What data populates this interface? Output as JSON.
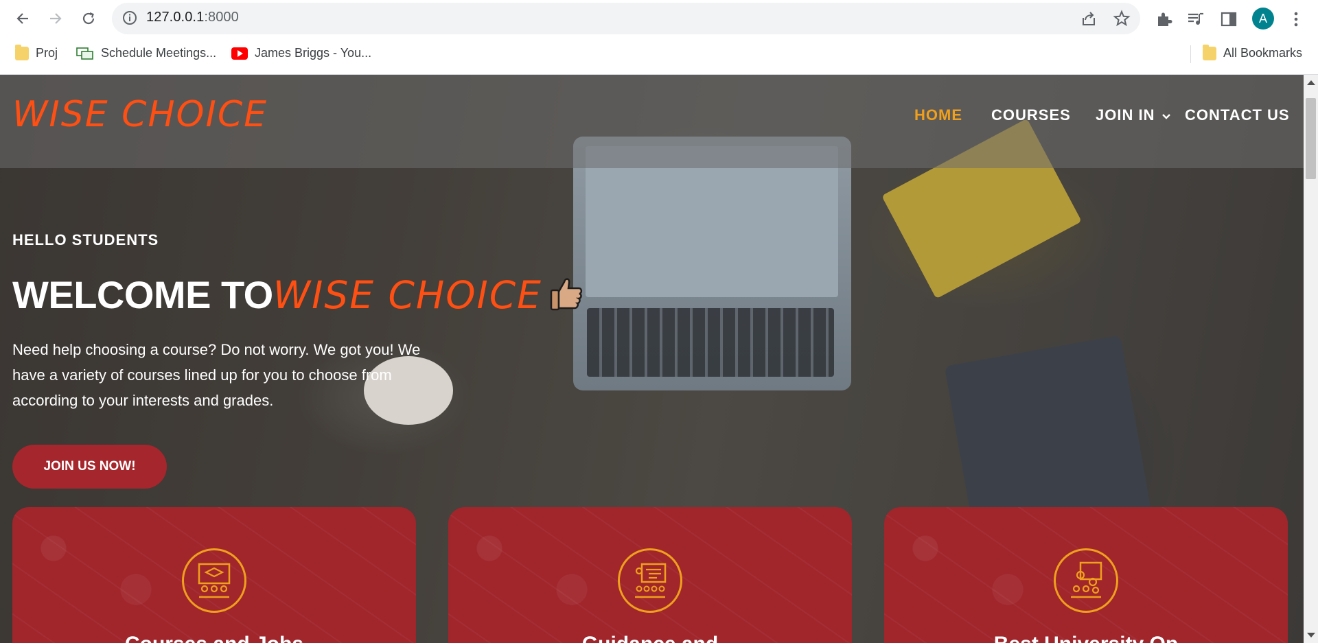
{
  "browser": {
    "url_host": "127.0.0.1",
    "url_port": ":8000",
    "avatar_letter": "A",
    "bookmarks": [
      {
        "label": "Proj",
        "icon": "folder-icon"
      },
      {
        "label": "Schedule Meetings...",
        "icon": "meetings-icon"
      },
      {
        "label": "James Briggs - You...",
        "icon": "youtube-icon"
      }
    ],
    "all_bookmarks_label": "All Bookmarks"
  },
  "site": {
    "logo": "WISE CHOICE",
    "nav": [
      "HOME",
      "COURSES",
      "JOIN IN",
      "CONTACT US"
    ],
    "active_nav": "HOME",
    "hero": {
      "subtitle": "HELLO STUDENTS",
      "title_prefix": "WELCOME TO",
      "title_brand": "WISE CHOICE",
      "description": "Need help choosing a course? Do not worry. We got you! We have a variety of courses lined up for you to choose from according to your interests and grades.",
      "cta": "JOIN US NOW!"
    },
    "cards": [
      {
        "title": "Courses and Jobs",
        "icon": "classroom-icon"
      },
      {
        "title": "Guidance and",
        "icon": "presentation-icon"
      },
      {
        "title": "Best University Op",
        "icon": "group-icon"
      }
    ]
  },
  "colors": {
    "brand_orange": "#ff4f12",
    "nav_active": "#f0a01c",
    "accent_red": "#a5262c",
    "icon_ring": "#f0a01c"
  }
}
